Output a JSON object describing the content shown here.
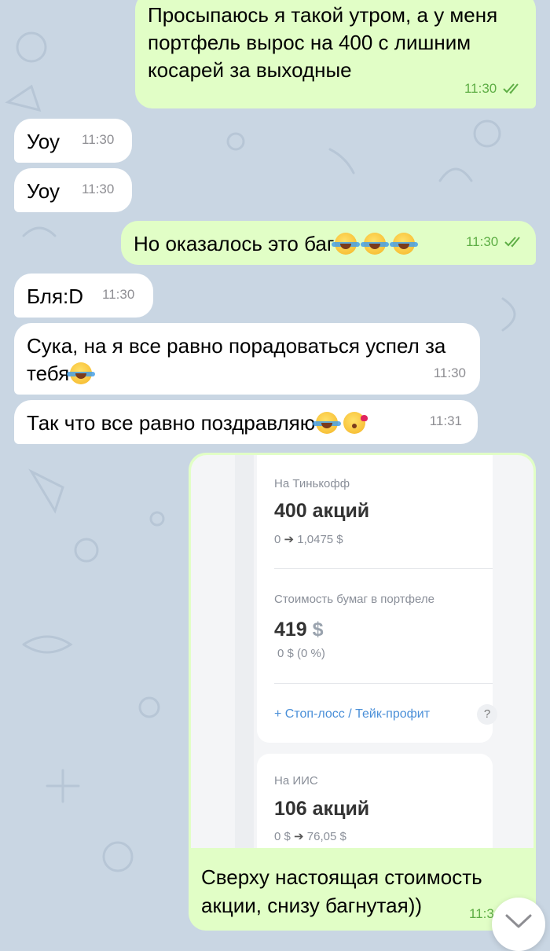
{
  "messages": [
    {
      "text": "Просыпаюсь я такой утром, а у меня портфель вырос на 400 с лишним косарей за выходные",
      "time": "11:30"
    },
    {
      "text": "Уоу",
      "time": "11:30"
    },
    {
      "text": "Уоу",
      "time": "11:30"
    },
    {
      "text": "Но оказалось это баг",
      "emoji": [
        "😂",
        "😂",
        "😂"
      ],
      "time": "11:30"
    },
    {
      "text": "Бля:D",
      "time": "11:30"
    },
    {
      "text": "Сука, на я все равно порадоваться успел за тебя",
      "emoji": [
        "😂"
      ],
      "time": "11:30"
    },
    {
      "text": "Так что все равно поздравляю",
      "emoji": [
        "😂",
        "😘"
      ],
      "time": "11:31"
    }
  ],
  "image_message": {
    "screenshot": {
      "card1": {
        "label": "На Тинькофф",
        "title": "400 акций",
        "sub_from": "0",
        "sub_to": "1,0475 $"
      },
      "card1b": {
        "label": "Стоимость бумаг в портфеле",
        "value": "419",
        "currency": "$",
        "change": "0 $ (0 %)",
        "link": "+ Стоп-лосс / Тейк-профит",
        "help": "?"
      },
      "card2": {
        "label": "На ИИС",
        "title": "106 акций",
        "sub_from": "0 $",
        "sub_to": "76,05 $"
      }
    },
    "caption": "Сверху настоящая стоимость акции, снизу багнутая))",
    "time": "11:3"
  },
  "colors": {
    "outgoing": "#e1fec6",
    "incoming": "#ffffff",
    "background": "#c9d6e3",
    "time_out": "#5eae45"
  }
}
